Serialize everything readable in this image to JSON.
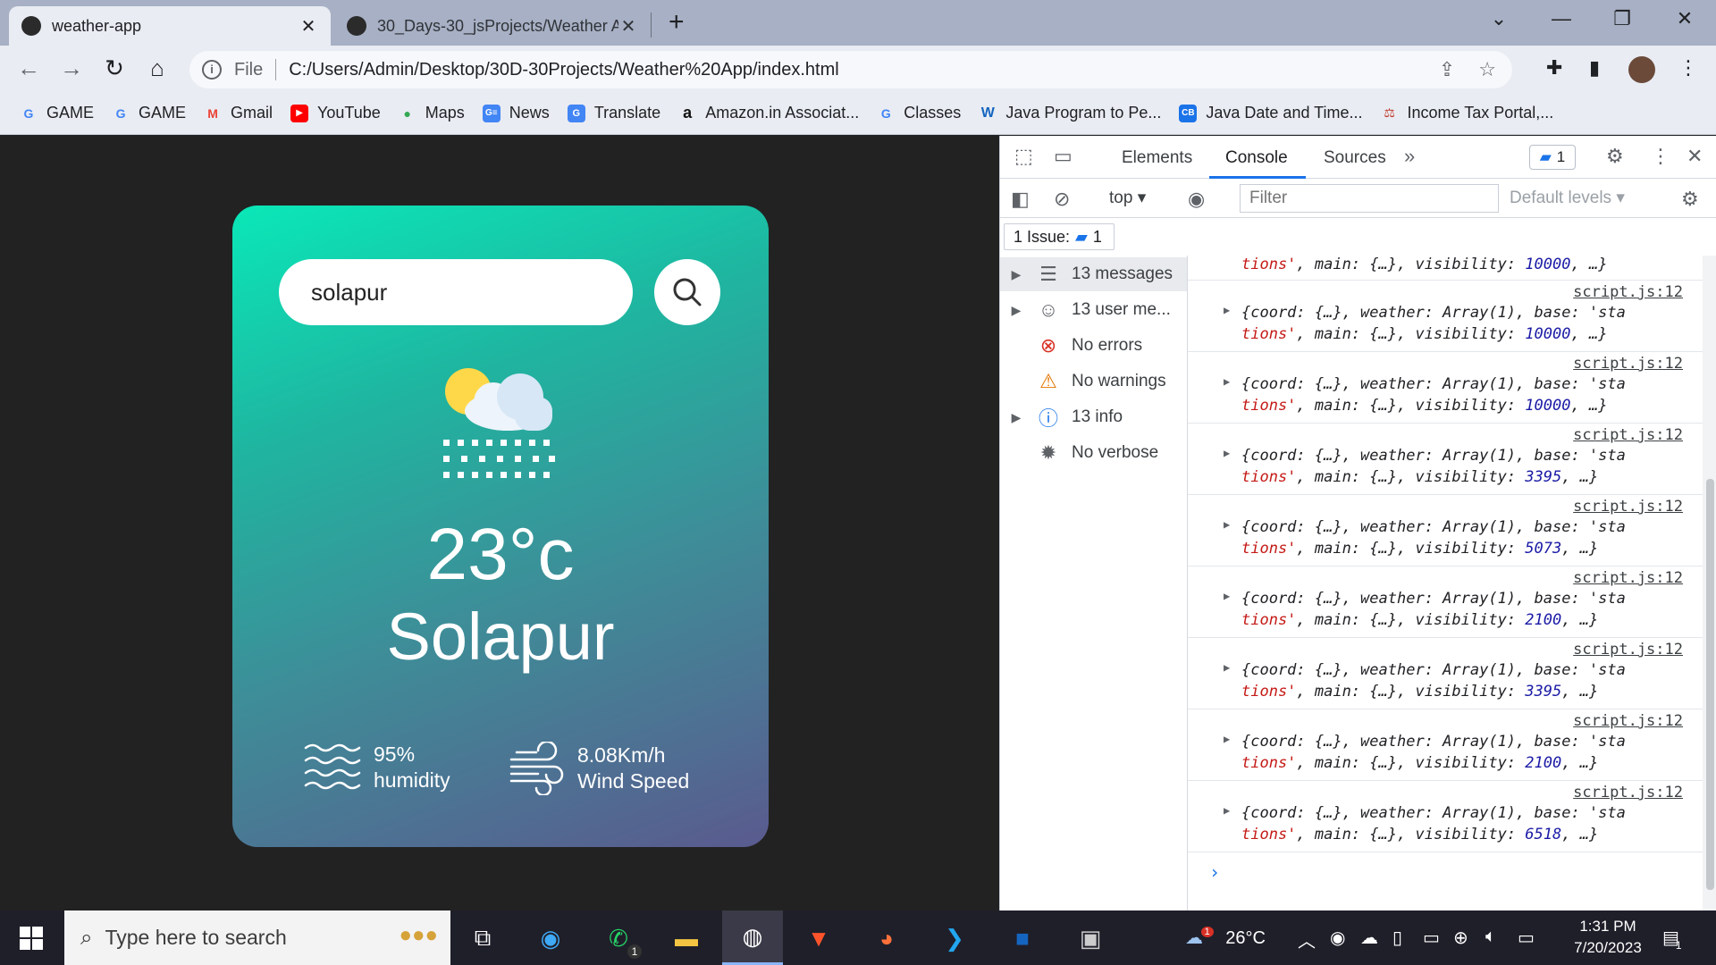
{
  "browser": {
    "tabs": [
      {
        "title": "weather-app",
        "active": true
      },
      {
        "title": "30_Days-30_jsProjects/Weather A",
        "active": false
      }
    ],
    "omnibox": {
      "scheme_label": "File",
      "url": "C:/Users/Admin/Desktop/30D-30Projects/Weather%20App/index.html"
    },
    "bookmarks": [
      {
        "label": "GAME",
        "icon": "google-icon"
      },
      {
        "label": "GAME",
        "icon": "google-icon"
      },
      {
        "label": "Gmail",
        "icon": "gmail-icon"
      },
      {
        "label": "YouTube",
        "icon": "youtube-icon"
      },
      {
        "label": "Maps",
        "icon": "maps-icon"
      },
      {
        "label": "News",
        "icon": "news-icon"
      },
      {
        "label": "Translate",
        "icon": "translate-icon"
      },
      {
        "label": "Amazon.in Associat...",
        "icon": "amazon-icon"
      },
      {
        "label": "Classes",
        "icon": "google-icon"
      },
      {
        "label": "Java Program to Pe...",
        "icon": "w3-icon"
      },
      {
        "label": "Java Date and Time...",
        "icon": "cb-icon"
      },
      {
        "label": "Income Tax Portal,...",
        "icon": "tax-icon"
      }
    ]
  },
  "app": {
    "search_value": "solapur",
    "temperature": "23°c",
    "city": "Solapur",
    "humidity_value": "95%",
    "humidity_label": "humidity",
    "wind_value": "8.08Km/h",
    "wind_label": "Wind Speed"
  },
  "devtools": {
    "tabs": [
      "Elements",
      "Console",
      "Sources"
    ],
    "active_tab": "Console",
    "issue_count": "1",
    "context": "top",
    "filter_placeholder": "Filter",
    "levels": "Default levels",
    "issues_label": "1 Issue:",
    "issues_count": "1",
    "sidebar": [
      {
        "label": "13 messages",
        "icon": "list-icon",
        "expandable": true
      },
      {
        "label": "13 user me...",
        "icon": "user-icon",
        "expandable": true
      },
      {
        "label": "No errors",
        "icon": "error-icon",
        "expandable": false
      },
      {
        "label": "No warnings",
        "icon": "warning-icon",
        "expandable": false
      },
      {
        "label": "13 info",
        "icon": "info-icon",
        "expandable": true
      },
      {
        "label": "No verbose",
        "icon": "bug-icon",
        "expandable": false
      }
    ],
    "log_source": "script.js:12",
    "log_line1": "{coord: {…}, weather: Array(1), base: 'sta",
    "logs_visibility": [
      "10000",
      "10000",
      "10000",
      "3395",
      "5073",
      "2100",
      "3395",
      "2100",
      "6518"
    ]
  },
  "taskbar": {
    "search_placeholder": "Type here to search",
    "weather_temp": "26°C",
    "weather_badge": "1",
    "whatsapp_badge": "1",
    "time": "1:31 PM",
    "date": "7/20/2023",
    "notification_count": "1"
  },
  "colors": {
    "card_gradient_start": "#0ae8b8",
    "card_gradient_end": "#5a5a8e",
    "page_background": "#222222",
    "devtools_accent": "#1a73e8"
  }
}
